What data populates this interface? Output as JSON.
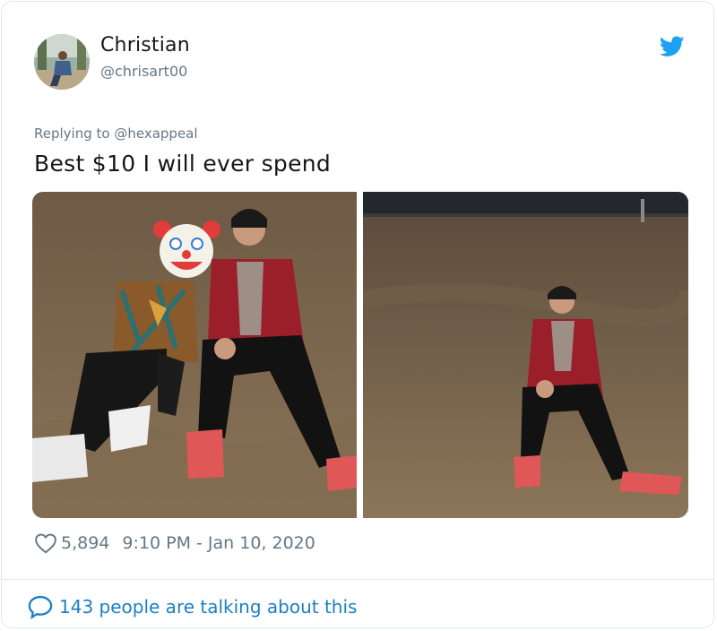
{
  "tweet": {
    "author_name": "Christian",
    "author_handle": "@chrisart00",
    "reply_prefix": "Replying to",
    "reply_handle": "@hexappeal",
    "text": "Best $10 I will ever spend",
    "likes": "5,894",
    "time": "9:10 PM",
    "date_separator": "-",
    "date": "Jan 10, 2020",
    "conversation": "143 people are talking about this"
  },
  "icons": {
    "brand": "twitter-bird-icon",
    "like": "heart-icon",
    "reply": "speech-bubble-icon",
    "face_cover": "clown-face-emoji"
  },
  "colors": {
    "brand_blue": "#1da1f2",
    "link_blue": "#1b7fc4",
    "secondary_text": "#657786",
    "primary_text": "#14171a"
  }
}
